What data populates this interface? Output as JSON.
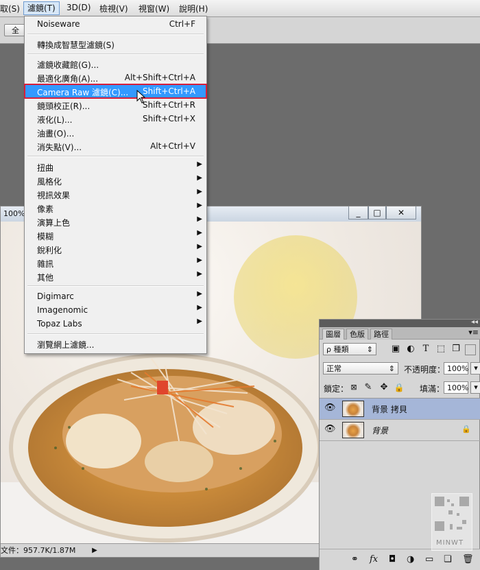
{
  "menubar": {
    "items": [
      "取(S)",
      "濾鏡(T)",
      "3D(D)",
      "檢視(V)",
      "視窗(W)",
      "說明(H)"
    ]
  },
  "optionsbar": {
    "button": "全"
  },
  "document": {
    "title": "100%",
    "statusbar": "文件：957.7K/1.87M",
    "controls": [
      "_",
      "□",
      "✕"
    ]
  },
  "filter_menu": {
    "groups": [
      [
        {
          "label": "Noiseware",
          "shortcut": "Ctrl+F"
        }
      ],
      [
        {
          "label": "轉換成智慧型濾鏡(S)",
          "shortcut": ""
        }
      ],
      [
        {
          "label": "濾鏡收藏館(G)...",
          "shortcut": ""
        },
        {
          "label": "最適化廣角(A)...",
          "shortcut": "Alt+Shift+Ctrl+A"
        },
        {
          "label": "Camera Raw 濾鏡(C)...",
          "shortcut": "Shift+Ctrl+A",
          "highlighted": true
        },
        {
          "label": "鏡頭校正(R)...",
          "shortcut": "Shift+Ctrl+R"
        },
        {
          "label": "液化(L)...",
          "shortcut": "Shift+Ctrl+X"
        },
        {
          "label": "油畫(O)...",
          "shortcut": ""
        },
        {
          "label": "消失點(V)...",
          "shortcut": "Alt+Ctrl+V"
        }
      ],
      [
        {
          "label": "扭曲",
          "submenu": true
        },
        {
          "label": "風格化",
          "submenu": true
        },
        {
          "label": "視訊效果",
          "submenu": true
        },
        {
          "label": "像素",
          "submenu": true
        },
        {
          "label": "演算上色",
          "submenu": true
        },
        {
          "label": "模糊",
          "submenu": true
        },
        {
          "label": "銳利化",
          "submenu": true
        },
        {
          "label": "雜訊",
          "submenu": true
        },
        {
          "label": "其他",
          "submenu": true
        }
      ],
      [
        {
          "label": "Digimarc",
          "submenu": true
        },
        {
          "label": "Imagenomic",
          "submenu": true
        },
        {
          "label": "Topaz Labs",
          "submenu": true
        }
      ],
      [
        {
          "label": "瀏覽網上濾鏡...",
          "shortcut": ""
        }
      ]
    ]
  },
  "layers_panel": {
    "tabs": [
      "圖層",
      "色版",
      "路徑"
    ],
    "kind_filter": "ρ 種類",
    "blend_mode": "正常",
    "opacity_label": "不透明度：",
    "opacity_value": "100%",
    "lock_label": "鎖定：",
    "fill_label": "填滿：",
    "fill_value": "100%",
    "layers": [
      {
        "name": "背景 拷貝",
        "selected": true,
        "locked": false
      },
      {
        "name": "背景",
        "selected": false,
        "locked": true
      }
    ],
    "footer_icons": [
      "link-icon",
      "fx-icon",
      "mask-icon",
      "adjustment-icon",
      "group-folder-icon",
      "new-layer-icon",
      "trash-icon"
    ]
  },
  "watermark": "MINWT",
  "colors": {
    "highlight": "#3399ff",
    "highlight_outline": "#d81e3a",
    "selected_layer": "#a5b6d8"
  }
}
